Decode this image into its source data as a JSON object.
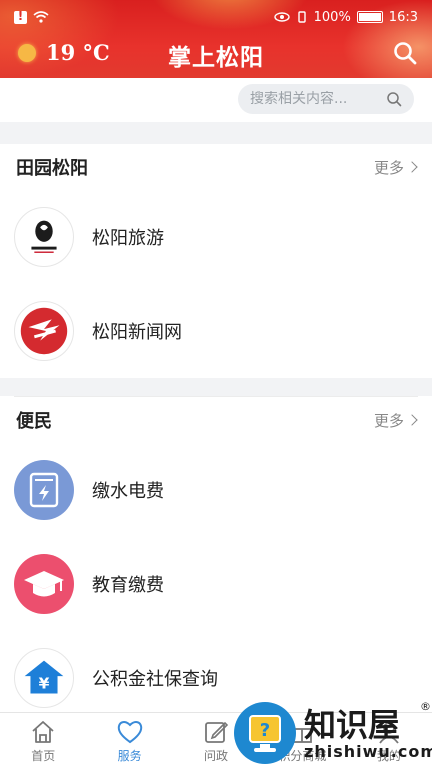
{
  "status_bar": {
    "battery": "100%",
    "time": "16:3"
  },
  "header": {
    "temperature": "19 °C",
    "title": "掌上松阳"
  },
  "search": {
    "placeholder": "搜索相关内容..."
  },
  "sections": [
    {
      "title": "田园松阳",
      "more": "更多",
      "items": [
        {
          "label": "松阳旅游",
          "icon": "songyang-tourism-logo-icon"
        },
        {
          "label": "松阳新闻网",
          "icon": "songyang-news-logo-icon"
        }
      ]
    },
    {
      "title": "便民",
      "more": "更多",
      "items": [
        {
          "label": "缴水电费",
          "icon": "utility-meter-icon"
        },
        {
          "label": "教育缴费",
          "icon": "graduation-cap-icon"
        },
        {
          "label": "公积金社保查询",
          "icon": "house-yen-icon"
        }
      ]
    }
  ],
  "bottom_nav": [
    {
      "label": "首页",
      "icon": "home-icon",
      "active": false
    },
    {
      "label": "服务",
      "icon": "heart-icon",
      "active": true
    },
    {
      "label": "问政",
      "icon": "edit-icon",
      "active": false
    },
    {
      "label": "积分商城",
      "icon": "gift-icon",
      "active": false
    },
    {
      "label": "我的",
      "icon": "user-icon",
      "active": false
    }
  ],
  "watermark": {
    "title": "知识屋",
    "url": "zhishiwu.com",
    "mark": "®"
  },
  "colors": {
    "header_red": "#e0302a",
    "accent_blue": "#3a8ad8",
    "education_pink": "#e94a6a",
    "utility_blue": "#6f8fd0"
  }
}
